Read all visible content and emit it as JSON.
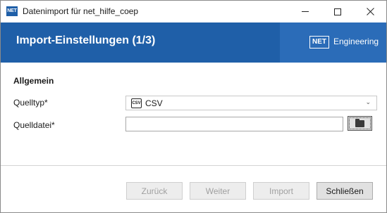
{
  "window": {
    "icon_text": "NET",
    "title": "Datenimport für net_hilfe_coep",
    "controls": {
      "minimize": "minimize-icon",
      "maximize": "maximize-icon",
      "close": "close-icon"
    }
  },
  "banner": {
    "title": "Import-Einstellungen (1/3)",
    "logo_text": "NET",
    "logo_label": "Engineering",
    "color": "#1f5fa8"
  },
  "form": {
    "section_title": "Allgemein",
    "source_type": {
      "label": "Quelltyp*",
      "value": "CSV",
      "icon": "csv-file-icon",
      "icon_text": "CSV"
    },
    "source_file": {
      "label": "Quelldatei*",
      "value": "",
      "browse_icon": "folder-open-icon"
    }
  },
  "footer": {
    "buttons": {
      "back": "Zurück",
      "next": "Weiter",
      "import": "Import",
      "close": "Schließen"
    }
  }
}
